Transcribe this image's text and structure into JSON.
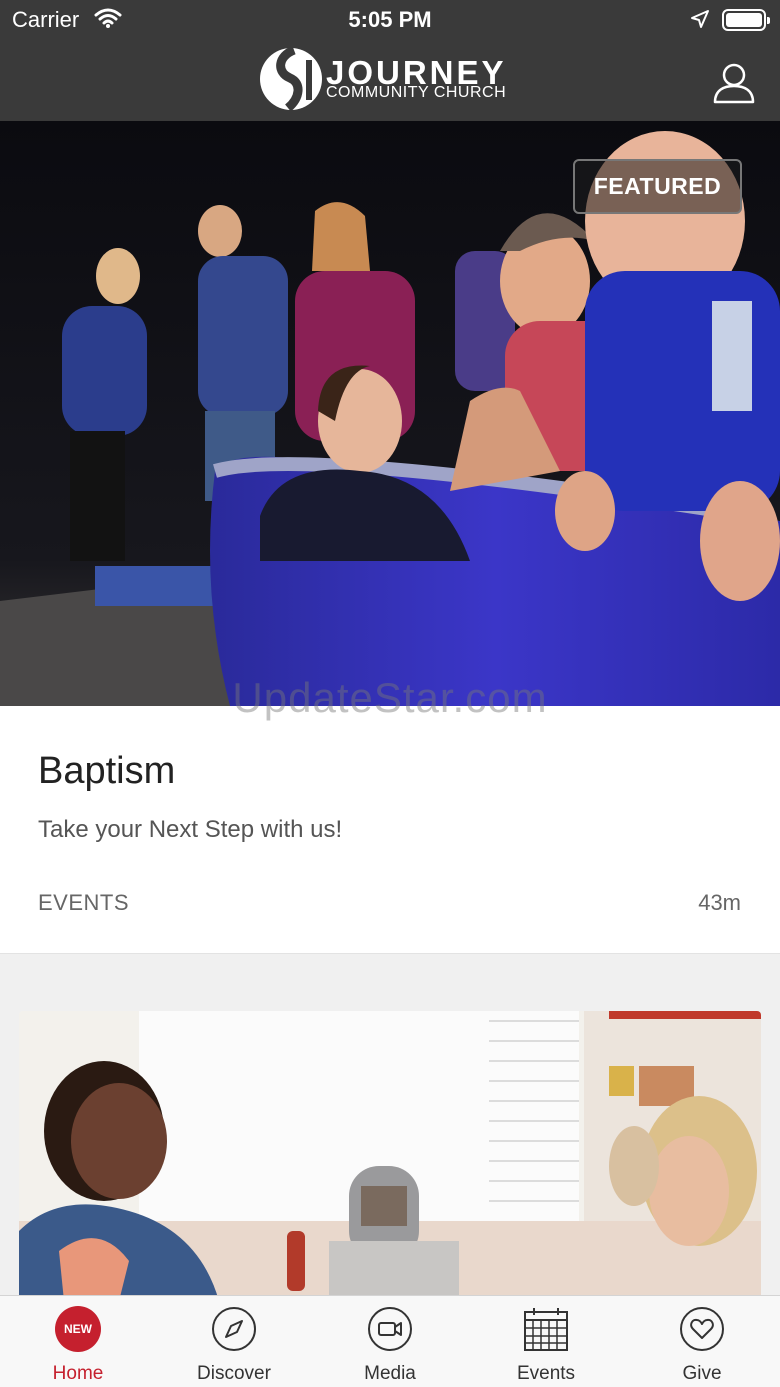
{
  "status_bar": {
    "carrier": "Carrier",
    "time": "5:05 PM"
  },
  "header": {
    "logo_name": "JOURNEY",
    "logo_sub": "COMMUNITY CHURCH"
  },
  "featured_card": {
    "badge": "FEATURED",
    "title": "Baptism",
    "subtitle": "Take your Next Step with us!",
    "category": "EVENTS",
    "time_ago": "43m"
  },
  "watermark": "UpdateStar.com",
  "tab_bar": {
    "home": {
      "badge": "NEW",
      "label": "Home"
    },
    "discover": {
      "label": "Discover"
    },
    "media": {
      "label": "Media"
    },
    "events": {
      "label": "Events"
    },
    "give": {
      "label": "Give"
    }
  },
  "colors": {
    "accent": "#c5202e",
    "header_bg": "#3a3a3a"
  }
}
